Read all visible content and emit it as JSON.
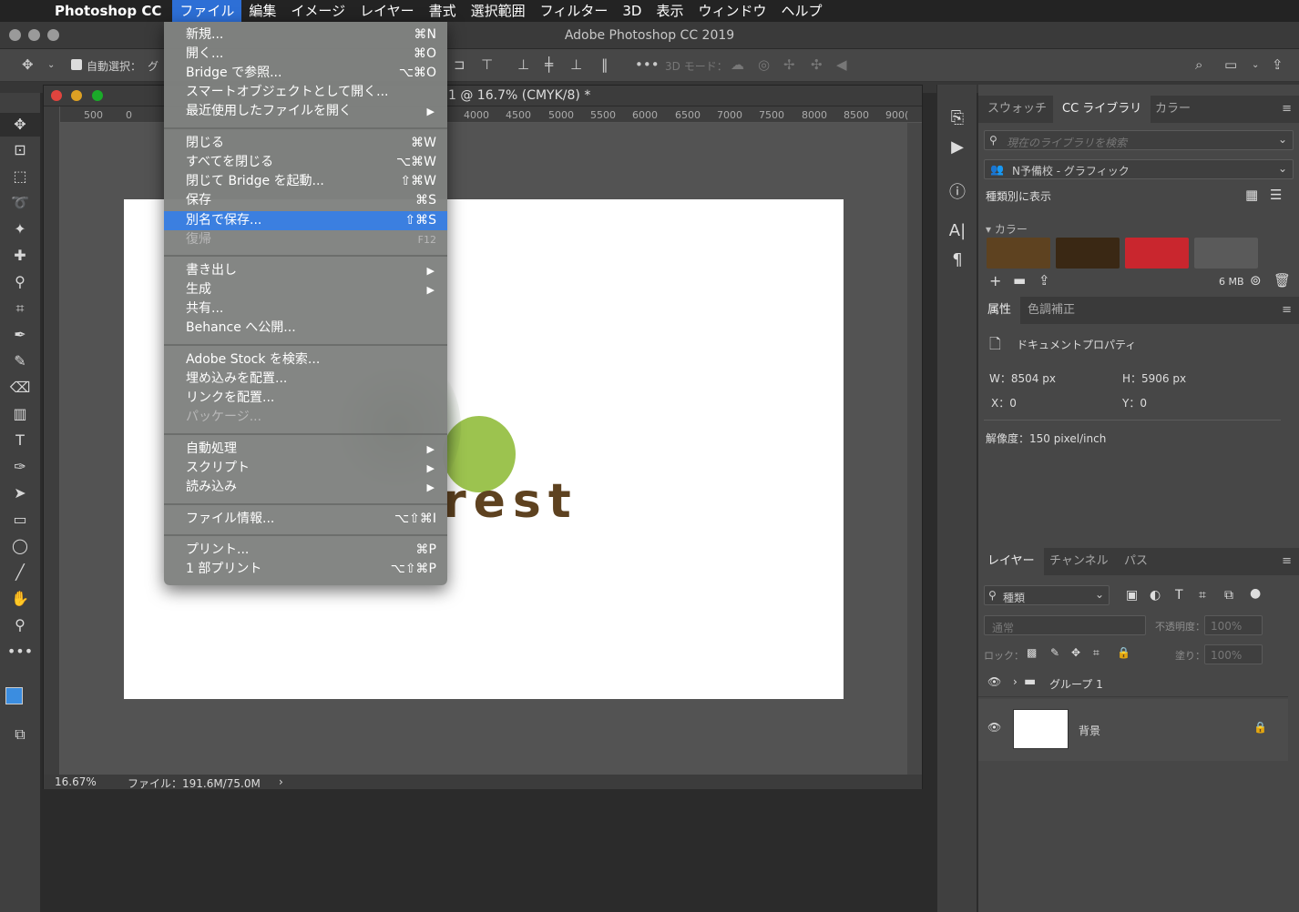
{
  "menubar": {
    "app": "Photoshop CC",
    "items": [
      "ファイル",
      "編集",
      "イメージ",
      "レイヤー",
      "書式",
      "選択範囲",
      "フィルター",
      "3D",
      "表示",
      "ウィンドウ",
      "ヘルプ"
    ]
  },
  "window": {
    "title": "Adobe Photoshop CC 2019"
  },
  "options": {
    "auto_select_label": "自動選択：",
    "auto_select_value": "グ",
    "mode_3d": "3D モード："
  },
  "document": {
    "title_fragment": "1 @ 16.7% (CMYK/8) *",
    "ruler_ticks": [
      "500",
      "0",
      "4000",
      "4500",
      "5000",
      "5500",
      "6000",
      "6500",
      "7000",
      "7500",
      "8000",
      "8500",
      "900("
    ],
    "zoom": "16.67%",
    "file_info": "ファイル：191.6M/75.0M",
    "artwork_text": "rest"
  },
  "file_menu": {
    "items": [
      {
        "label": "新規...",
        "shortcut": "⌘N"
      },
      {
        "label": "開く...",
        "shortcut": "⌘O"
      },
      {
        "label": "Bridge で参照...",
        "shortcut": "⌥⌘O"
      },
      {
        "label": "スマートオブジェクトとして開く...",
        "shortcut": ""
      },
      {
        "label": "最近使用したファイルを開く",
        "shortcut": "▶"
      },
      {
        "label": "閉じる",
        "shortcut": "⌘W"
      },
      {
        "label": "すべてを閉じる",
        "shortcut": "⌥⌘W"
      },
      {
        "label": "閉じて Bridge を起動...",
        "shortcut": "⇧⌘W"
      },
      {
        "label": "保存",
        "shortcut": "⌘S"
      },
      {
        "label": "別名で保存...",
        "shortcut": "⇧⌘S"
      },
      {
        "label": "復帰",
        "shortcut": "F12"
      },
      {
        "label": "書き出し",
        "shortcut": "▶"
      },
      {
        "label": "生成",
        "shortcut": "▶"
      },
      {
        "label": "共有...",
        "shortcut": ""
      },
      {
        "label": "Behance へ公開...",
        "shortcut": ""
      },
      {
        "label": "Adobe Stock を検索...",
        "shortcut": ""
      },
      {
        "label": "埋め込みを配置...",
        "shortcut": ""
      },
      {
        "label": "リンクを配置...",
        "shortcut": ""
      },
      {
        "label": "パッケージ...",
        "shortcut": ""
      },
      {
        "label": "自動処理",
        "shortcut": "▶"
      },
      {
        "label": "スクリプト",
        "shortcut": "▶"
      },
      {
        "label": "読み込み",
        "shortcut": "▶"
      },
      {
        "label": "ファイル情報...",
        "shortcut": "⌥⇧⌘I"
      },
      {
        "label": "プリント...",
        "shortcut": "⌘P"
      },
      {
        "label": "1 部プリント",
        "shortcut": "⌥⇧⌘P"
      }
    ]
  },
  "library_panel": {
    "tabs": [
      "スウォッチ",
      "CC ライブラリ",
      "カラー"
    ],
    "search_placeholder": "現在のライブラリを検索",
    "library_name": "N予備校 - グラフィック",
    "view_by": "種類別に表示",
    "section": "カラー",
    "colors": [
      "#5e4220",
      "#3a2814",
      "#c9262e",
      "#5a5a5a"
    ],
    "storage": "6 MB"
  },
  "properties_panel": {
    "tabs": [
      "属性",
      "色調補正"
    ],
    "header": "ドキュメントプロパティ",
    "w": "W：8504 px",
    "h": "H：5906 px",
    "x": "X：0",
    "y": "Y：0",
    "resolution": "解像度：150 pixel/inch"
  },
  "layers_panel": {
    "tabs": [
      "レイヤー",
      "チャンネル",
      "パス"
    ],
    "filter": "種類",
    "blend": "通常",
    "opacity_label": "不透明度：",
    "opacity": "100%",
    "lock_label": "ロック：",
    "fill_label": "塗り：",
    "fill": "100%",
    "layers": [
      {
        "name": "グループ 1"
      },
      {
        "name": "背景"
      }
    ]
  }
}
